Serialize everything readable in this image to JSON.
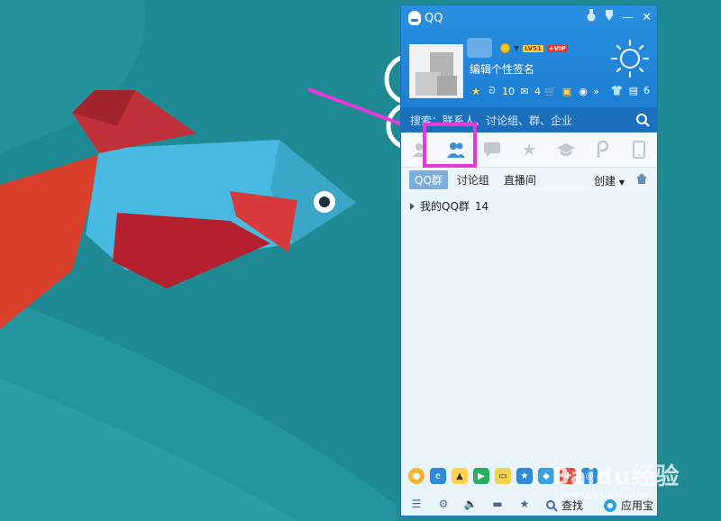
{
  "window": {
    "title": "QQ",
    "controls": {
      "skin": "medal-icon",
      "menu": "▾",
      "minimize": "—",
      "close": "✕"
    }
  },
  "profile": {
    "signature": "编辑个性签名",
    "level": "LV51",
    "vip": "+VIP",
    "counts": {
      "qzone": "10",
      "mail": "4",
      "games": "6"
    },
    "more": "»"
  },
  "search": {
    "placeholder": "搜索：联系人、讨论组、群、企业"
  },
  "tabs": [
    {
      "name": "contacts",
      "active": false
    },
    {
      "name": "groups",
      "active": true
    },
    {
      "name": "recent",
      "active": false
    },
    {
      "name": "favorites",
      "active": false
    },
    {
      "name": "class",
      "active": false
    },
    {
      "name": "qzone",
      "active": false
    },
    {
      "name": "phone",
      "active": false
    }
  ],
  "subtabs": {
    "qqgroup": "QQ群",
    "discussion": "讨论组",
    "live": "直播间",
    "create": "创建"
  },
  "groups": [
    {
      "label": "我的QQ群",
      "count": "14"
    }
  ],
  "bottom": {
    "find": "查找",
    "appstore": "应用宝"
  },
  "watermark": {
    "brand": "Baidu经验",
    "url": "jingyan.baidu.com"
  },
  "colors": {
    "accent": "#1d7fd4",
    "highlight": "#e63ad8",
    "desktop": "#1f8a94"
  }
}
